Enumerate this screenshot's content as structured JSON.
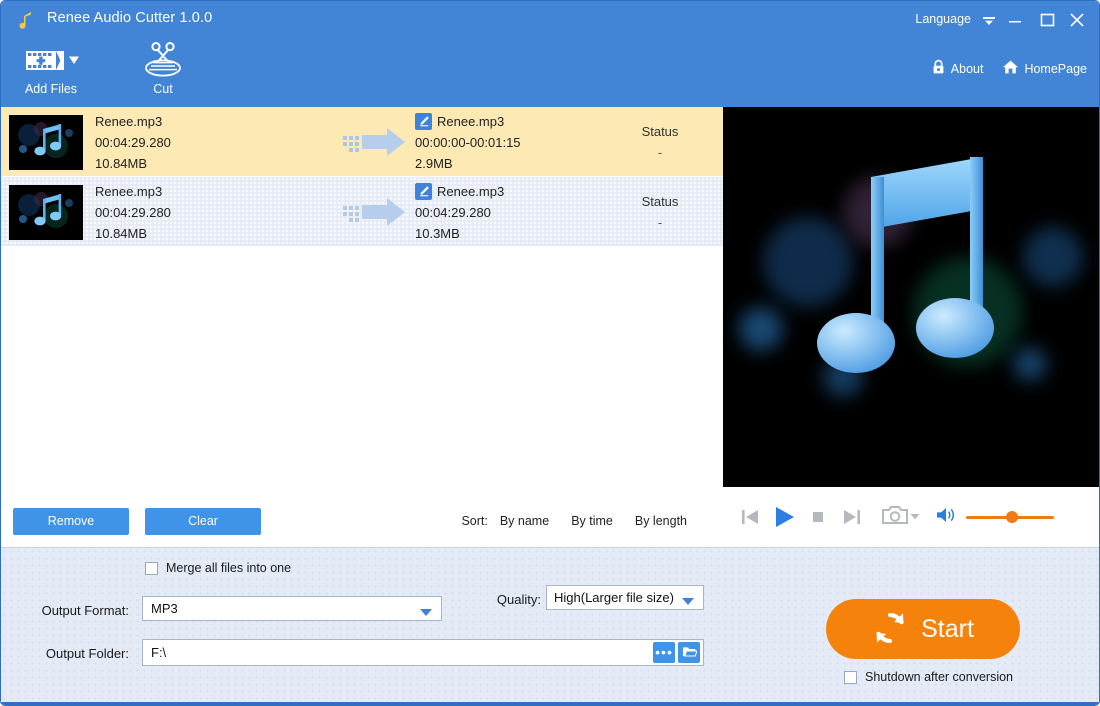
{
  "window": {
    "title": "Renee Audio Cutter 1.0.0",
    "logo_icon": "music-note-icon",
    "language_label": "Language",
    "language_caret_icon": "chevron-down-icon",
    "minimize_icon": "minimize-icon",
    "maximize_icon": "maximize-icon",
    "close_icon": "close-icon",
    "accent_blue": "#4285d6"
  },
  "toolbar": {
    "items": [
      {
        "label": "Add Files",
        "icon": "add-files-icon",
        "has_dropdown": true
      },
      {
        "label": "Cut",
        "icon": "scissors-icon",
        "has_dropdown": false
      }
    ],
    "links": [
      {
        "label": "About",
        "icon": "lock-icon"
      },
      {
        "label": "HomePage",
        "icon": "home-icon"
      }
    ]
  },
  "file_list": {
    "rows": [
      {
        "selected": true,
        "thumbnail": "music-note-artwork",
        "source": {
          "name": "Renee.mp3",
          "duration": "00:04:29.280",
          "size": "10.84MB"
        },
        "arrow_icon": "arrow-right-icon",
        "target": {
          "edit_icon": "edit-pencil-icon",
          "name": "Renee.mp3",
          "range": "00:00:00-00:01:15",
          "size": "2.9MB"
        },
        "status_label": "Status",
        "status_value": "-"
      },
      {
        "selected": false,
        "thumbnail": "music-note-artwork",
        "source": {
          "name": "Renee.mp3",
          "duration": "00:04:29.280",
          "size": "10.84MB"
        },
        "arrow_icon": "arrow-right-icon",
        "target": {
          "edit_icon": "edit-pencil-icon",
          "name": "Renee.mp3",
          "range": "00:04:29.280",
          "size": "10.3MB"
        },
        "status_label": "Status",
        "status_value": "-"
      }
    ]
  },
  "list_actions": {
    "remove_label": "Remove",
    "clear_label": "Clear",
    "sort_label": "Sort:",
    "sort_options": [
      "By name",
      "By time",
      "By length"
    ]
  },
  "player": {
    "previous_icon": "skip-previous-icon",
    "play_icon": "play-icon",
    "stop_icon": "stop-icon",
    "next_icon": "skip-next-icon",
    "snapshot_icon": "camera-icon",
    "snapshot_caret_icon": "chevron-down-icon",
    "volume_icon": "volume-icon",
    "volume_percent": 45,
    "slider_color": "#ef7a18"
  },
  "settings": {
    "merge_label": "Merge all files into one",
    "merge_checked": false,
    "output_format_label": "Output Format:",
    "output_format_value": "MP3",
    "quality_label": "Quality:",
    "quality_value": "High(Larger file size)",
    "output_folder_label": "Output Folder:",
    "output_folder_value": "F:\\",
    "output_folder_placeholder": "F:\\",
    "browse_dots_label": "•••",
    "open_folder_icon": "folder-open-icon",
    "start_label": "Start",
    "start_icon": "refresh-icon",
    "start_color": "#f5820b",
    "shutdown_label": "Shutdown after conversion",
    "shutdown_checked": false
  }
}
